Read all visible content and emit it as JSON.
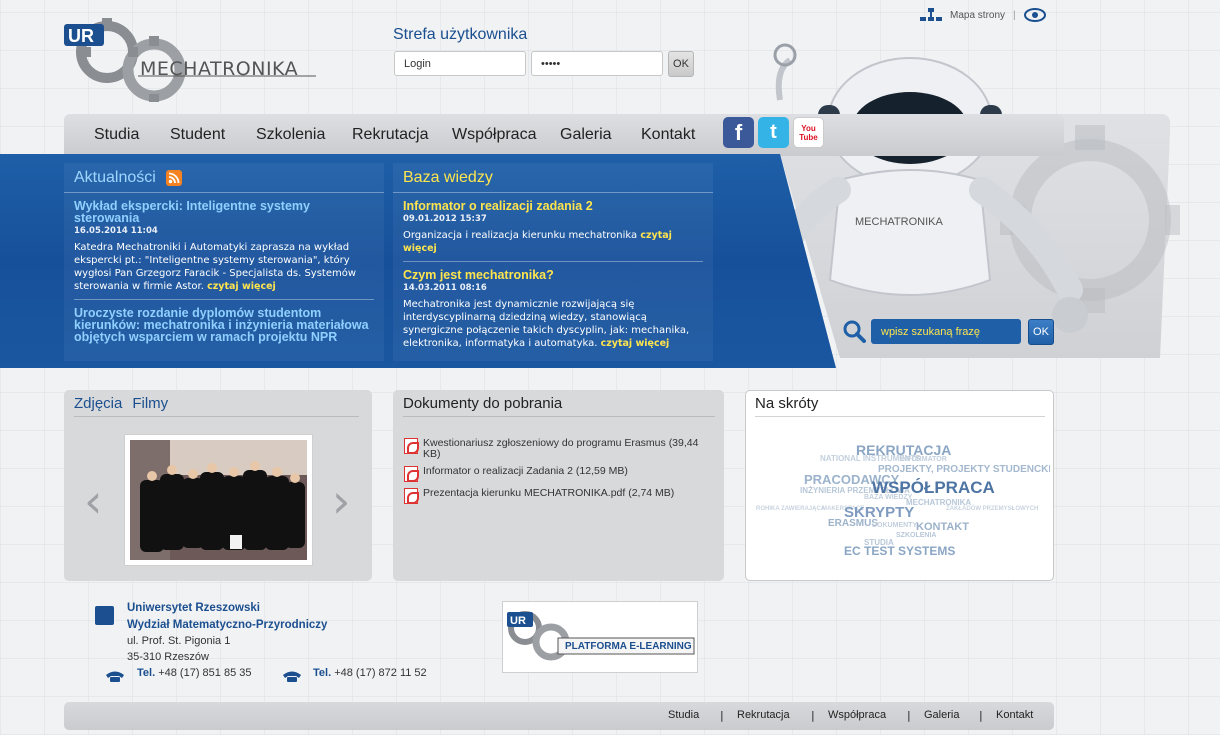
{
  "header": {
    "logo_text": "MECHATRONIKA",
    "top_links": {
      "sitemap": "Mapa strony"
    },
    "login": {
      "title": "Strefa użytkownika",
      "login_value": "Login",
      "password_value": "•••••",
      "ok_label": "OK"
    }
  },
  "nav": {
    "items": [
      "Studia",
      "Student",
      "Szkolenia",
      "Rekrutacja",
      "Współpraca",
      "Galeria",
      "Kontakt"
    ]
  },
  "news": {
    "title": "Aktualności",
    "articles": [
      {
        "title": "Wykład ekspercki: Inteligentne systemy sterowania",
        "date": "16.05.2014 11:04",
        "text": "Katedra Mechatroniki i Automatyki zaprasza na wykład ekspercki pt.: \"Inteligentne systemy sterowania\", który wygłosi Pan Grzegorz Faracik - Specjalista ds. Systemów sterowania w firmie Astor.",
        "more": "czytaj więcej"
      },
      {
        "title": "Uroczyste rozdanie dyplomów studentom kierunków: mechatronika i inżynieria materiałowa objętych wsparciem w ramach projektu NPR",
        "date": "",
        "text": "",
        "more": ""
      }
    ]
  },
  "baza": {
    "title": "Baza wiedzy",
    "articles": [
      {
        "title": "Informator o realizacji zadania 2",
        "date": "09.01.2012 15:37",
        "text": "Organizacja i realizacja kierunku mechatronika",
        "more": "czytaj więcej"
      },
      {
        "title": "Czym jest mechatronika?",
        "date": "14.03.2011 08:16",
        "text": "Mechatronika jest dynamicznie rozwijającą się interdyscyplinarną dziedziną wiedzy, stanowiącą synergiczne połączenie takich dyscyplin, jak: mechanika, elektronika, informatyka i automatyka.",
        "more": "czytaj więcej"
      }
    ]
  },
  "search": {
    "placeholder": "wpisz szukaną frazę",
    "ok_label": "OK"
  },
  "social": {
    "facebook": "f",
    "twitter": "t",
    "youtube": "You Tube"
  },
  "photos": {
    "tab_photos": "Zdjęcia",
    "tab_films": "Filmy",
    "prev": "‹",
    "next": "›"
  },
  "documents": {
    "title": "Dokumenty do pobrania",
    "items": [
      "Kwestionariusz zgłoszeniowy do programu Erasmus (39,44 KB)",
      "Informator o realizacji Zadania 2 (12,59 MB)",
      "Prezentacja kierunku MECHATRONIKA.pdf (2,74 MB)"
    ]
  },
  "shortcuts": {
    "title": "Na skróty",
    "words": [
      "REKRUTACJA",
      "NATIONAL INSTRUMENTS",
      "INFORMATOR",
      "PROJEKTY, PROJEKTY STUDENCKIE",
      "PRACODAWCY",
      "INŻYNIERIA PRZEMYSŁOWA",
      "WSPÓŁPRACA",
      "BAZA WIEDZY",
      "MECHATRONIKA",
      "ROHIKA ZAWIERAJĄCA",
      "MAKERSPACE",
      "ZAKŁADÓW PRZEMYSŁOWYCH",
      "SKRYPTY",
      "ERASMUS",
      "DOKUMENTY",
      "KONTAKT",
      "SZKOLENIA",
      "STUDIA",
      "EC TEST SYSTEMS"
    ]
  },
  "footer": {
    "org1": "Uniwersytet Rzeszowski",
    "org2": "Wydział Matematyczno-Przyrodniczy",
    "addr1": "ul. Prof. St. Pigonia 1",
    "addr2": "35-310 Rzeszów",
    "tel_label": "Tel.",
    "phone1": "+48 (17) 851 85 35",
    "phone2": "+48 (17) 872 11 52",
    "elearning": "PLATFORMA E-LEARNING",
    "links": [
      "Studia",
      "Rekrutacja",
      "Współpraca",
      "Galeria",
      "Kontakt"
    ]
  },
  "colors": {
    "brand_blue": "#1b4f8f",
    "band_blue": "#1e5fa8",
    "highlight_yellow": "#ffe54d"
  }
}
